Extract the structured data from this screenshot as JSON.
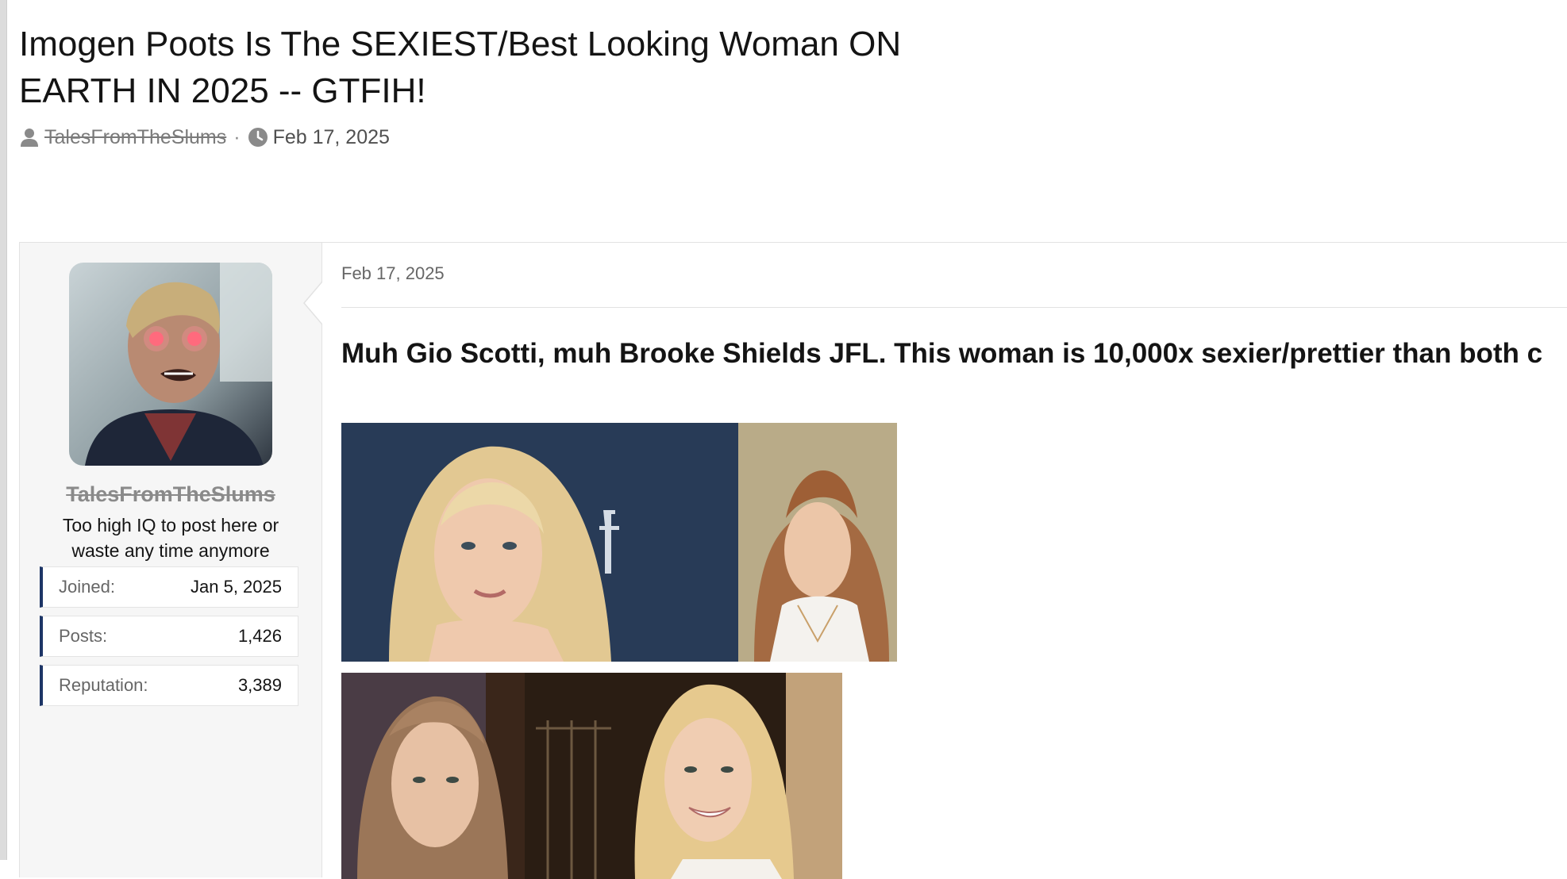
{
  "thread": {
    "title": "Imogen Poots Is The SEXIEST/Best Looking Woman ON EARTH IN 2025 -- GTFIH!",
    "author": "TalesFromTheSlums",
    "separator": "·",
    "date": "Feb 17, 2025"
  },
  "post": {
    "date": "Feb 17, 2025",
    "text": "Muh Gio Scotti, muh Brooke Shields JFL. This woman is 10,000x sexier/prettier than both c",
    "user": {
      "name": "TalesFromTheSlums",
      "title": "Too high IQ to post here or waste any time anymore",
      "stats": [
        {
          "label": "Joined:",
          "value": "Jan 5, 2025"
        },
        {
          "label": "Posts:",
          "value": "1,426"
        },
        {
          "label": "Reputation:",
          "value": "3,389"
        }
      ]
    }
  },
  "colors": {
    "accent": "#1d3566",
    "sidebar_bg": "#f6f6f6",
    "text": "#141414",
    "muted": "#666666"
  },
  "icons": [
    "user-icon",
    "clock-icon"
  ]
}
